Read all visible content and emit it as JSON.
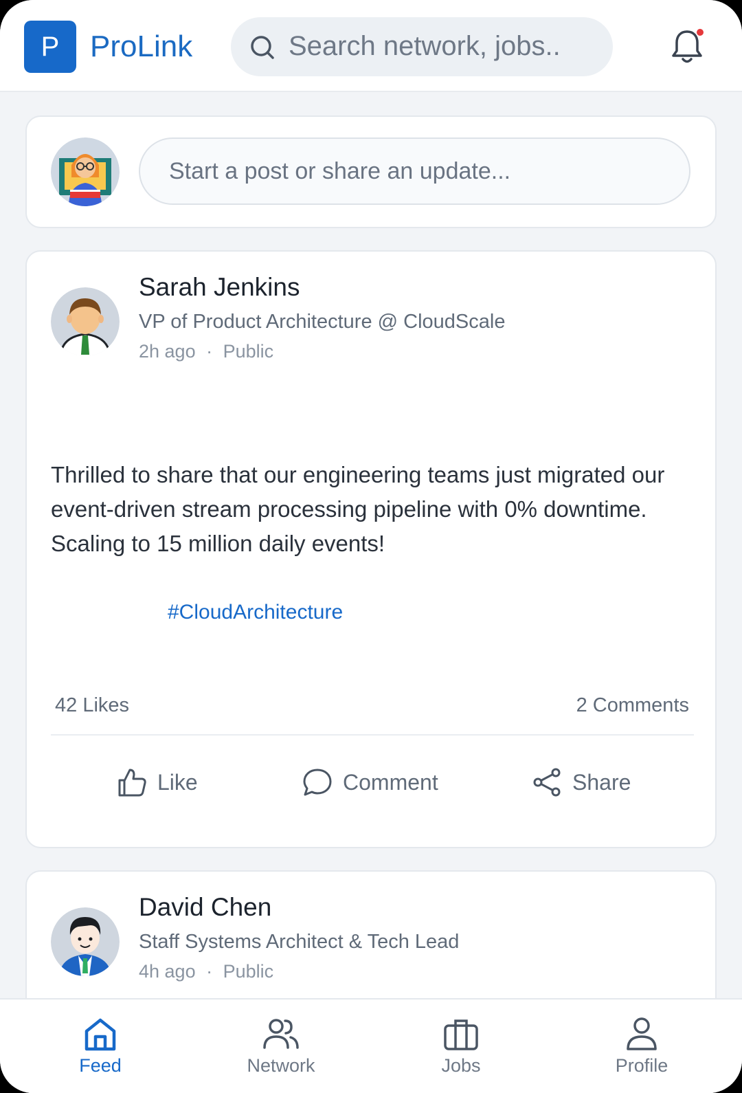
{
  "header": {
    "logo_letter": "P",
    "app_name": "ProLink",
    "search_placeholder": "Search network, jobs..",
    "notification_dot_color": "#e5383b"
  },
  "composer": {
    "placeholder": "Start a post or share an update..."
  },
  "posts": [
    {
      "author": "Sarah Jenkins",
      "title": "VP of Product Architecture @ CloudScale",
      "time": "2h ago",
      "visibility": "Public",
      "body": "Thrilled to share that our engineering teams just migrated our event-driven stream processing pipeline with 0% downtime. Scaling to 15 million daily events!",
      "hashtag": "#CloudArchitecture",
      "likes": "42 Likes",
      "comments": "2 Comments",
      "actions": [
        "Like",
        "Comment",
        "Share"
      ]
    },
    {
      "author": "David Chen",
      "title": "Staff Systems Architect & Tech Lead",
      "time": "4h ago",
      "visibility": "Public"
    }
  ],
  "separator": "·",
  "bottom_nav": {
    "items": [
      {
        "label": "Feed",
        "icon": "home-icon",
        "active": true
      },
      {
        "label": "Network",
        "icon": "people-icon",
        "active": false
      },
      {
        "label": "Jobs",
        "icon": "briefcase-icon",
        "active": false
      },
      {
        "label": "Profile",
        "icon": "person-icon",
        "active": false
      }
    ]
  },
  "colors": {
    "accent": "#1769c9",
    "background": "#f2f4f7",
    "card": "#ffffff"
  }
}
